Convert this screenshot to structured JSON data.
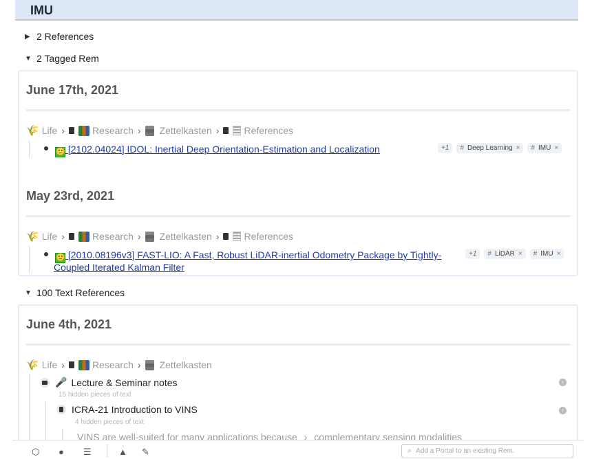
{
  "page": {
    "title": "IMU"
  },
  "references_toggle": {
    "label": "2 References"
  },
  "tagged_toggle": {
    "label": "2 Tagged Rem"
  },
  "text_refs_toggle": {
    "label": "100 Text References"
  },
  "tagged": [
    {
      "date": "June 17th, 2021",
      "breadcrumb": [
        "Life",
        "Research",
        "Zettelkasten",
        "References"
      ],
      "link": "[2102.04024] IDOL: Inertial Deep Orientation-Estimation and Localization",
      "plus": "+1",
      "tags": [
        "Deep Learning",
        "IMU"
      ]
    },
    {
      "date": "May 23rd, 2021",
      "breadcrumb": [
        "Life",
        "Research",
        "Zettelkasten",
        "References"
      ],
      "link_line1": "[2010.08196v3] FAST-LIO: A Fast, Robust LiDAR-inertial Odometry Package by Tightly-",
      "link_line2": "Coupled Iterated Kalman Filter",
      "plus": "+1",
      "tags": [
        "LiDAR",
        "IMU"
      ]
    }
  ],
  "text_refs": {
    "date": "June 4th, 2021",
    "breadcrumb": [
      "Life",
      "Research",
      "Zettelkasten"
    ],
    "item1": {
      "label": "Lecture & Seminar notes",
      "hidden": "15 hidden pieces of text"
    },
    "item2": {
      "label": "ICRA-21 Introduction to VINS",
      "hidden": "4 hidden pieces of text"
    },
    "snippet_a": "VINS are well-suited for many applications because",
    "snippet_b": "complementary sensing modalities"
  },
  "bottom": {
    "search_placeholder": "Add a Portal to an existing Rem."
  },
  "icons": {
    "tri_right": "▸",
    "tri_down": "▾",
    "flag": "🌾",
    "mic": "🎤",
    "smile": "🙂",
    "bottom": [
      "cube-icon",
      "bulb-icon",
      "menu-icon",
      "warning-icon",
      "brush-icon"
    ]
  }
}
